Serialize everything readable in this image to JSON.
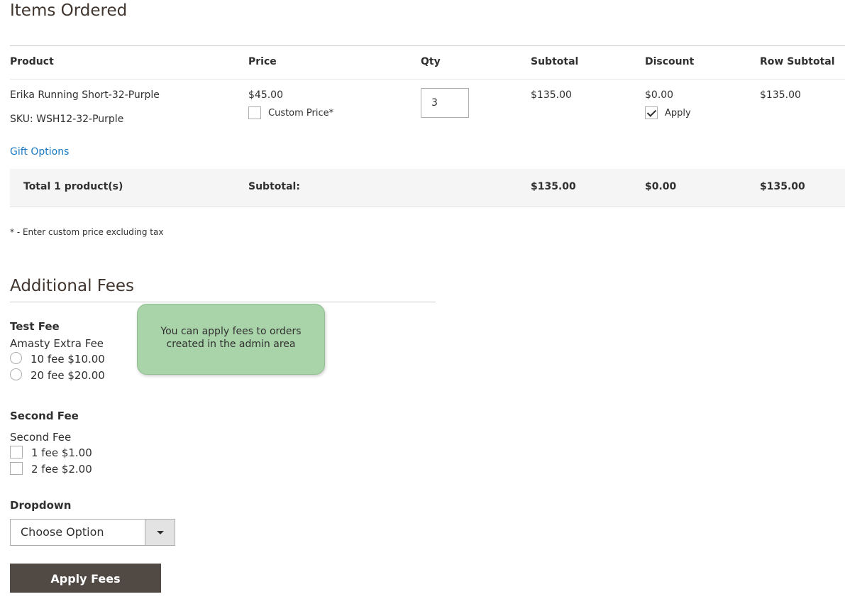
{
  "items_section": {
    "title": "Items Ordered",
    "columns": [
      "Product",
      "Price",
      "Qty",
      "Subtotal",
      "Discount",
      "Row Subtotal"
    ],
    "rows": [
      {
        "product_name": "Erika Running Short-32-Purple",
        "sku": "SKU: WSH12-32-Purple",
        "price": "$45.00",
        "custom_price_label": "Custom Price*",
        "qty": "3",
        "subtotal": "$135.00",
        "discount": "$0.00",
        "apply_label": "Apply",
        "row_subtotal": "$135.00"
      }
    ],
    "gift_options": "Gift Options",
    "totals": {
      "label": "Total 1 product(s)",
      "subtotal_label": "Subtotal:",
      "subtotal": "$135.00",
      "discount": "$0.00",
      "row_subtotal": "$135.00"
    },
    "note": "* - Enter custom price excluding tax"
  },
  "fees_section": {
    "title": "Additional Fees",
    "tooltip": "You can apply fees to orders created in the admin area",
    "test_fee": {
      "title": "Test Fee",
      "subtitle": "Amasty Extra Fee",
      "options": [
        "10 fee $10.00",
        "20 fee $20.00"
      ]
    },
    "second_fee": {
      "title": "Second Fee",
      "subtitle": "Second Fee",
      "options": [
        "1 fee $1.00",
        "2 fee $2.00"
      ]
    },
    "dropdown": {
      "title": "Dropdown",
      "selected": "Choose Option"
    },
    "apply_button": "Apply Fees"
  },
  "colors": {
    "link": "#1979c3",
    "button_bg": "#514943",
    "tooltip_bg": "#a9d3a8"
  }
}
